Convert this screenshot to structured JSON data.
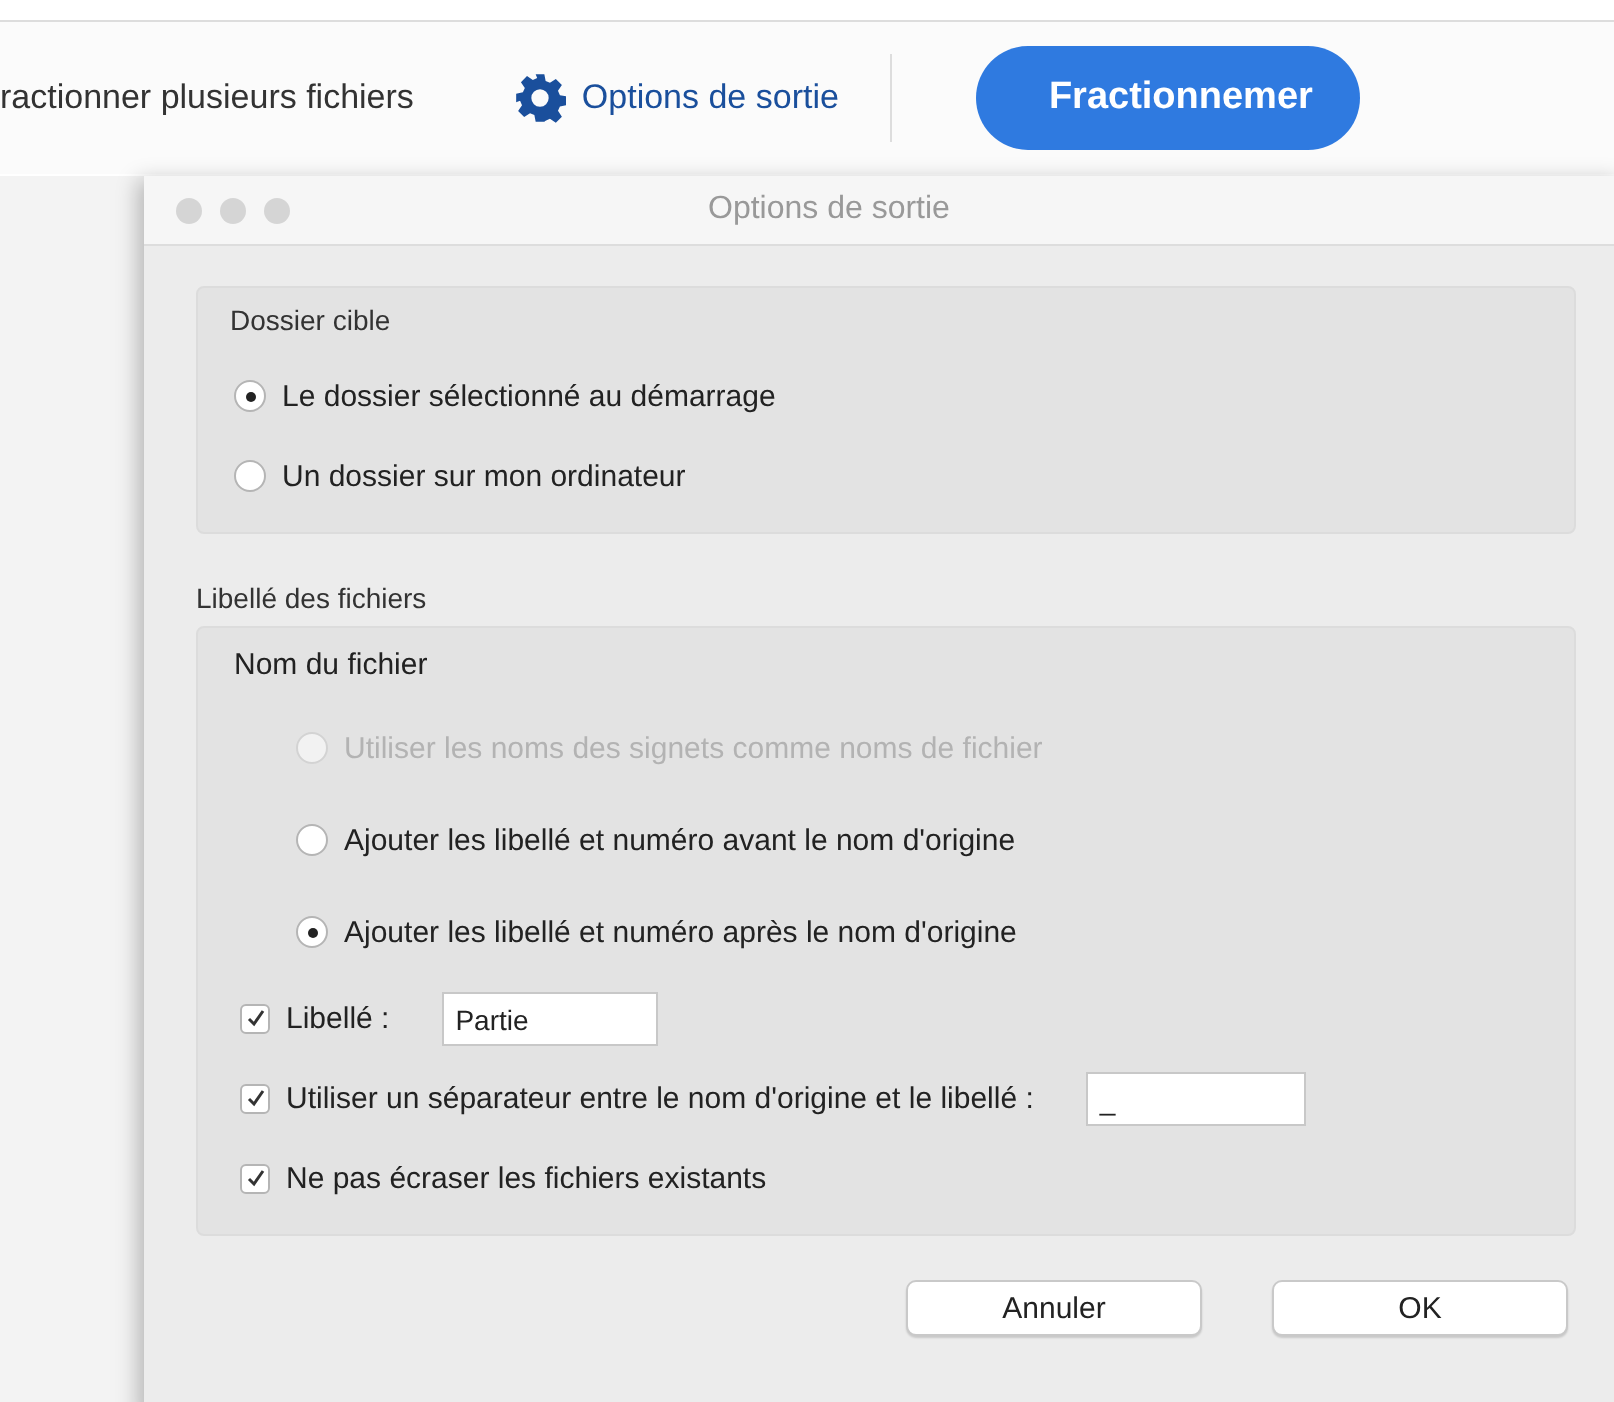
{
  "toolbar": {
    "split_label": "ractionner plusieurs fichiers",
    "options_link": "Options de sortie",
    "primary_button": "Fractionnemer"
  },
  "dialog": {
    "title": "Options de sortie",
    "target_folder": {
      "title": "Dossier cible",
      "options": [
        {
          "label": "Le dossier sélectionné au démarrage",
          "selected": true,
          "disabled": false
        },
        {
          "label": "Un dossier sur mon ordinateur",
          "selected": false,
          "disabled": false
        }
      ]
    },
    "naming": {
      "title": "Libellé des fichiers",
      "subtitle": "Nom du fichier",
      "options": [
        {
          "label": "Utiliser les noms des signets comme noms de fichier",
          "selected": false,
          "disabled": true
        },
        {
          "label": "Ajouter les libellé et numéro avant le nom d'origine",
          "selected": false,
          "disabled": false
        },
        {
          "label": "Ajouter les libellé et numéro après le nom d'origine",
          "selected": true,
          "disabled": false
        }
      ],
      "checks": [
        {
          "kind": "field",
          "label": "Libellé :",
          "checked": true,
          "value": "Partie"
        },
        {
          "kind": "wide-field",
          "label": "Utiliser un séparateur entre le nom d'origine et le libellé :",
          "checked": true,
          "value": "_"
        },
        {
          "kind": "plain",
          "label": "Ne pas écraser les fichiers existants",
          "checked": true
        }
      ]
    },
    "buttons": [
      "Annuler",
      "OK"
    ]
  }
}
